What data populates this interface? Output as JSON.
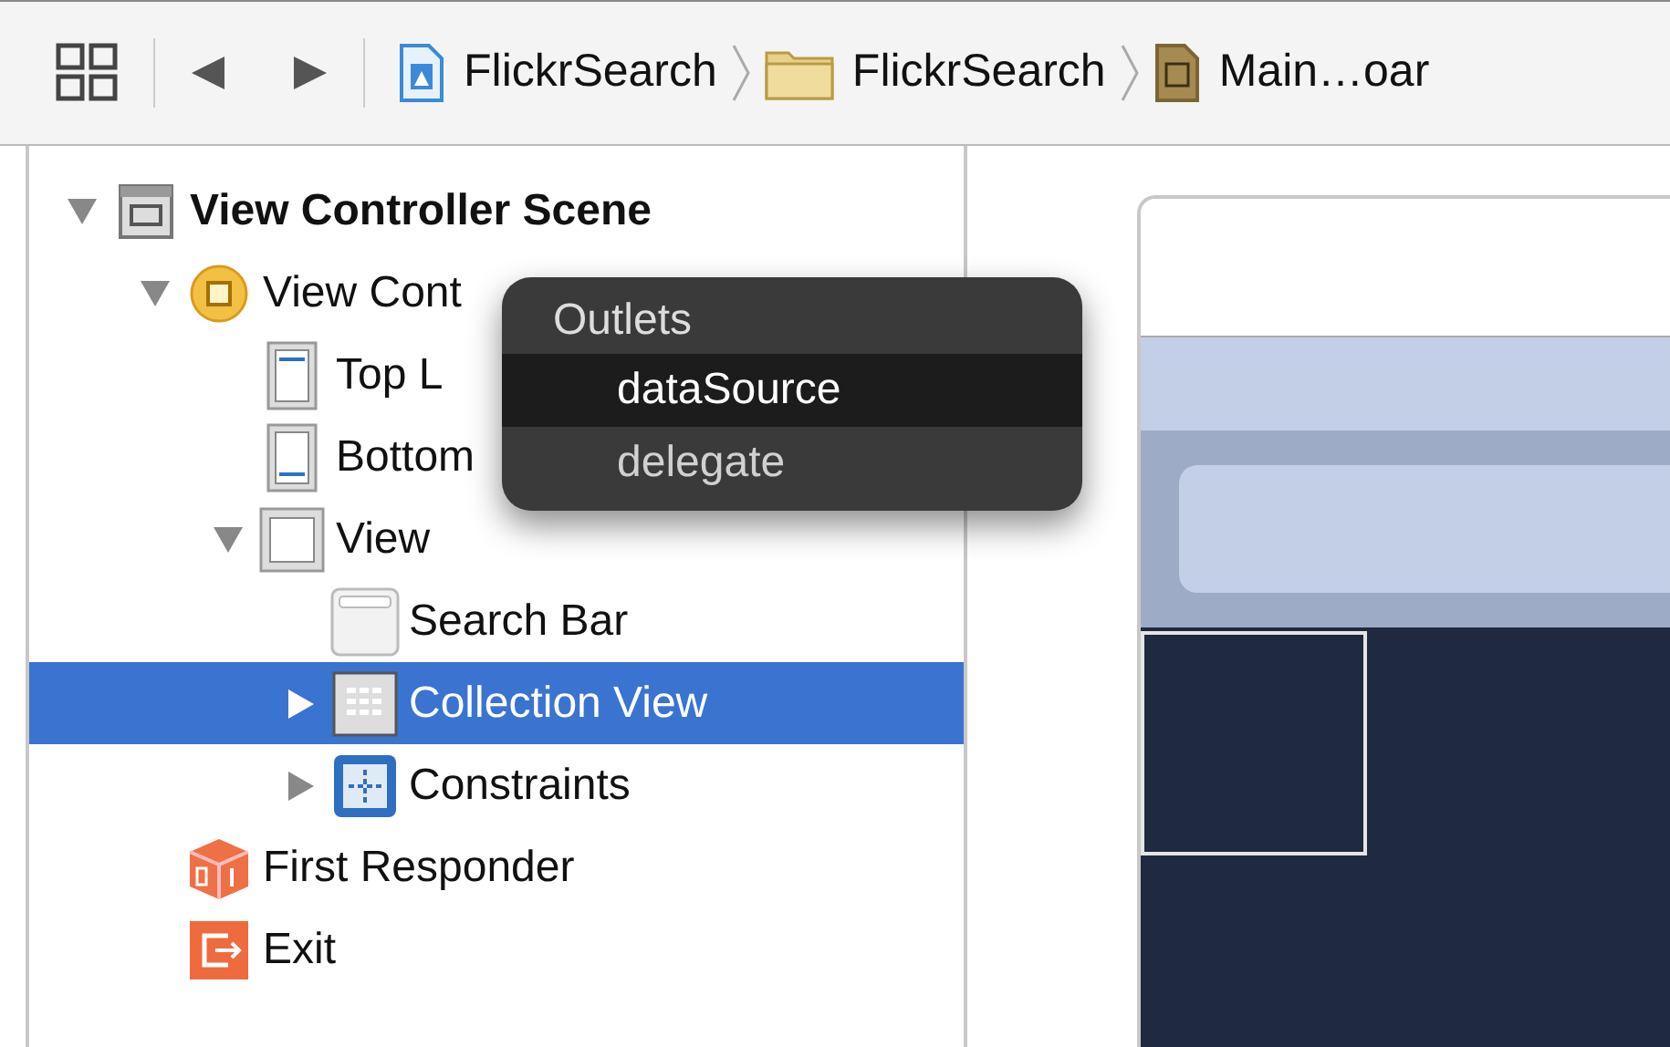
{
  "toolbar": {
    "breadcrumbs": [
      {
        "kind": "project",
        "label": "FlickrSearch"
      },
      {
        "kind": "folder",
        "label": "FlickrSearch"
      },
      {
        "kind": "storyboard",
        "label": "Main…oar"
      }
    ]
  },
  "outline": [
    {
      "kind": "scene",
      "label": "View Controller Scene",
      "bold": true,
      "expanded": true,
      "selected": false,
      "children": [
        {
          "kind": "controller",
          "label": "View Cont",
          "expanded": true,
          "selected": false,
          "children": [
            {
              "kind": "top-guide",
              "label": "Top L",
              "selected": false
            },
            {
              "kind": "bottom-guide",
              "label": "Bottom",
              "selected": false
            },
            {
              "kind": "view",
              "label": "View",
              "expanded": true,
              "selected": false,
              "children": [
                {
                  "kind": "search-bar",
                  "label": "Search Bar",
                  "selected": false
                },
                {
                  "kind": "collection",
                  "label": "Collection View",
                  "expanded": false,
                  "selected": true
                },
                {
                  "kind": "constraints",
                  "label": "Constraints",
                  "expanded": false,
                  "selected": false
                }
              ]
            }
          ]
        },
        {
          "kind": "responder",
          "label": "First Responder",
          "selected": false
        },
        {
          "kind": "exit",
          "label": "Exit",
          "selected": false
        }
      ]
    }
  ],
  "outlets_popup": {
    "title": "Outlets",
    "items": [
      {
        "label": "dataSource",
        "selected": true
      },
      {
        "label": "delegate",
        "selected": false
      }
    ]
  }
}
